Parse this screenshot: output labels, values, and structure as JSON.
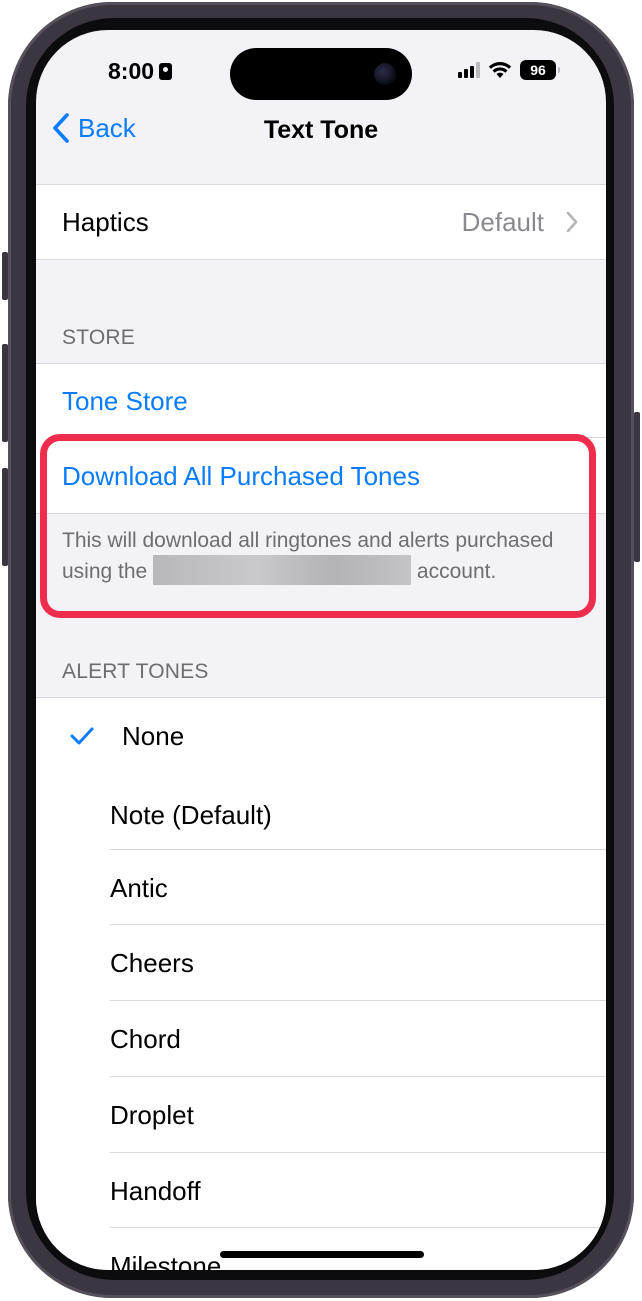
{
  "status_bar": {
    "time": "8:00",
    "battery": "96"
  },
  "nav": {
    "back_label": "Back",
    "title": "Text Tone"
  },
  "haptics": {
    "label": "Haptics",
    "value": "Default"
  },
  "store": {
    "header": "STORE",
    "tone_store_label": "Tone Store",
    "download_label": "Download All Purchased Tones",
    "note_before": "This will download all ringtones and alerts purchased using the",
    "note_after": "account."
  },
  "alert_tones": {
    "header": "ALERT TONES",
    "selected": "None",
    "items": [
      "None",
      "Note (Default)",
      "Antic",
      "Cheers",
      "Chord",
      "Droplet",
      "Handoff",
      "Milestone"
    ]
  },
  "colors": {
    "accent": "#0a7cff",
    "highlight_border": "#ee2c4d",
    "background": "#f2f2f7"
  }
}
